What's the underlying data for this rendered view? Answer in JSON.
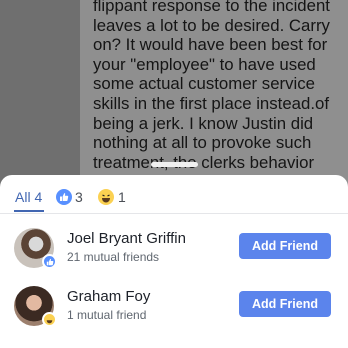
{
  "comment": {
    "lines": [
      "flippant response to the incident",
      "leaves a lot to be desired. Carry",
      "on? It would have been best for",
      "your \"employee\" to have used",
      "some actual customer service",
      "skills in the first place instead.of",
      "being a jerk. I know Justin did",
      "nothing at all to provoke such",
      "treatment, the clerks behavior"
    ]
  },
  "reactions": {
    "tabs": {
      "all": "All 4",
      "like_count": "3",
      "haha_count": "1"
    },
    "people": [
      {
        "name": "Joel Bryant Griffin",
        "mutual": "21 mutual friends",
        "reaction": "like-icon",
        "button": "Add Friend"
      },
      {
        "name": "Graham Foy",
        "mutual": "1 mutual friend",
        "reaction": "haha-icon",
        "button": "Add Friend"
      }
    ]
  },
  "colors": {
    "accent": "#4267b2",
    "button": "#5b84ec",
    "like": "#5890ff",
    "haha": "#fbd152"
  }
}
